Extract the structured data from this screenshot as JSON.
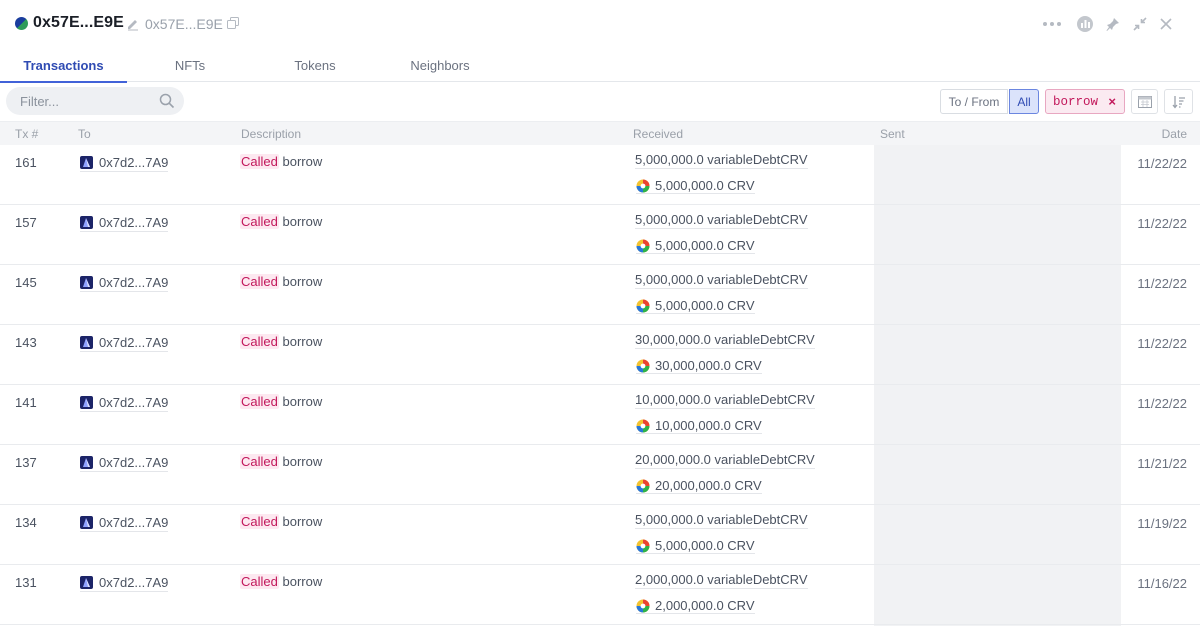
{
  "header": {
    "title": "0x57E...E9E",
    "sub_address": "0x57E...E9E"
  },
  "tabs": [
    {
      "label": "Transactions",
      "active": true
    },
    {
      "label": "NFTs",
      "active": false
    },
    {
      "label": "Tokens",
      "active": false
    },
    {
      "label": "Neighbors",
      "active": false
    }
  ],
  "toolbar": {
    "filter_placeholder": "Filter...",
    "to_from_label": "To / From",
    "all_label": "All",
    "chip_label": "borrow",
    "chip_remove": "×"
  },
  "columns": {
    "tx": "Tx #",
    "to": "To",
    "description": "Description",
    "received": "Received",
    "sent": "Sent",
    "date": "Date"
  },
  "rows": [
    {
      "tx": "161",
      "to": "0x7d2...7A9",
      "called": "Called",
      "method": "borrow",
      "received_debt": "5,000,000.0 variableDebtCRV",
      "received_crv": "5,000,000.0 CRV",
      "date": "11/22/22"
    },
    {
      "tx": "157",
      "to": "0x7d2...7A9",
      "called": "Called",
      "method": "borrow",
      "received_debt": "5,000,000.0 variableDebtCRV",
      "received_crv": "5,000,000.0 CRV",
      "date": "11/22/22"
    },
    {
      "tx": "145",
      "to": "0x7d2...7A9",
      "called": "Called",
      "method": "borrow",
      "received_debt": "5,000,000.0 variableDebtCRV",
      "received_crv": "5,000,000.0 CRV",
      "date": "11/22/22"
    },
    {
      "tx": "143",
      "to": "0x7d2...7A9",
      "called": "Called",
      "method": "borrow",
      "received_debt": "30,000,000.0 variableDebtCRV",
      "received_crv": "30,000,000.0 CRV",
      "date": "11/22/22"
    },
    {
      "tx": "141",
      "to": "0x7d2...7A9",
      "called": "Called",
      "method": "borrow",
      "received_debt": "10,000,000.0 variableDebtCRV",
      "received_crv": "10,000,000.0 CRV",
      "date": "11/22/22"
    },
    {
      "tx": "137",
      "to": "0x7d2...7A9",
      "called": "Called",
      "method": "borrow",
      "received_debt": "20,000,000.0 variableDebtCRV",
      "received_crv": "20,000,000.0 CRV",
      "date": "11/21/22"
    },
    {
      "tx": "134",
      "to": "0x7d2...7A9",
      "called": "Called",
      "method": "borrow",
      "received_debt": "5,000,000.0 variableDebtCRV",
      "received_crv": "5,000,000.0 CRV",
      "date": "11/19/22"
    },
    {
      "tx": "131",
      "to": "0x7d2...7A9",
      "called": "Called",
      "method": "borrow",
      "received_debt": "2,000,000.0 variableDebtCRV",
      "received_crv": "2,000,000.0 CRV",
      "date": "11/16/22"
    }
  ],
  "colors": {
    "accent": "#4162d8",
    "method_pink": "#c2185b",
    "sent_column_bg": "#f1f2f4"
  }
}
